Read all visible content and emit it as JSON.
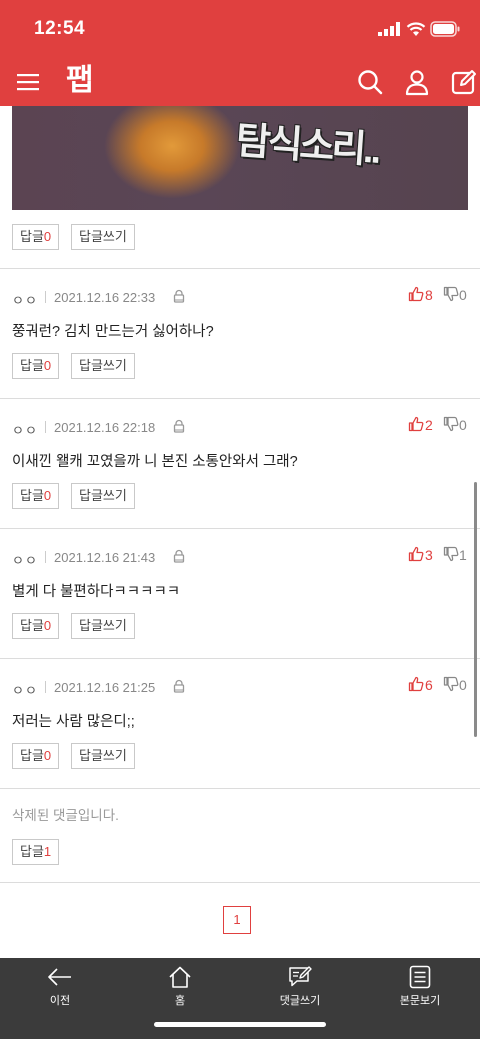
{
  "status_bar": {
    "time": "12:54"
  },
  "nav": {
    "logo": "팹"
  },
  "image_comment": {
    "overlay_text": "탐식소리..",
    "reply_label": "답글",
    "reply_count": "0",
    "write_label": "답글쓰기"
  },
  "comments": [
    {
      "author": "ㅇㅇ",
      "date": "2021.12.16 22:33",
      "up": "8",
      "down": "0",
      "body": "쭝궈런? 김치 만드는거 싫어하나?",
      "reply_label": "답글",
      "reply_count": "0",
      "write_label": "답글쓰기"
    },
    {
      "author": "ㅇㅇ",
      "date": "2021.12.16 22:18",
      "up": "2",
      "down": "0",
      "body": "이새낀 왤캐 꼬였을까 니 본진 소통안와서 그래?",
      "reply_label": "답글",
      "reply_count": "0",
      "write_label": "답글쓰기"
    },
    {
      "author": "ㅇㅇ",
      "date": "2021.12.16 21:43",
      "up": "3",
      "down": "1",
      "body": "별게 다 불편하다ㅋㅋㅋㅋㅋ",
      "reply_label": "답글",
      "reply_count": "0",
      "write_label": "답글쓰기"
    },
    {
      "author": "ㅇㅇ",
      "date": "2021.12.16 21:25",
      "up": "6",
      "down": "0",
      "body": "저러는 사람 많은디;;",
      "reply_label": "답글",
      "reply_count": "0",
      "write_label": "답글쓰기"
    }
  ],
  "deleted_comment": {
    "text": "삭제된 댓글입니다.",
    "reply_label": "답글",
    "reply_count": "1"
  },
  "pagination": {
    "current": "1"
  },
  "tabbar": [
    {
      "label": "이전",
      "icon": "back-arrow-icon"
    },
    {
      "label": "홈",
      "icon": "home-icon"
    },
    {
      "label": "댓글쓰기",
      "icon": "write-comment-icon"
    },
    {
      "label": "본문보기",
      "icon": "article-icon"
    }
  ],
  "colors": {
    "brand": "#e0403f",
    "tabbar": "#3b3b3b"
  }
}
